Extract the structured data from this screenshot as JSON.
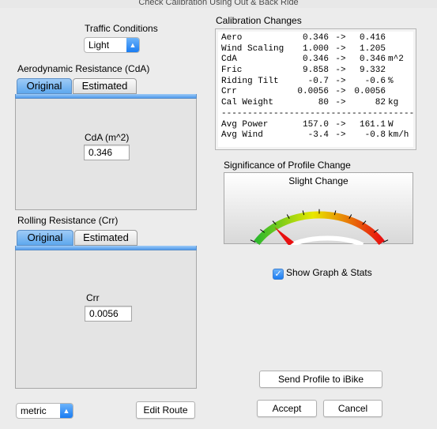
{
  "window": {
    "title": "Check Calibration Using Out & Back Ride"
  },
  "traffic": {
    "label": "Traffic Conditions",
    "selected": "Light"
  },
  "cda": {
    "section_label": "Aerodynamic Resistance (CdA)",
    "tabs": [
      "Original",
      "Estimated"
    ],
    "field_label": "CdA (m^2)",
    "value": "0.346"
  },
  "crr": {
    "section_label": "Rolling Resistance (Crr)",
    "tabs": [
      "Original",
      "Estimated"
    ],
    "field_label": "Crr",
    "value": "0.0056"
  },
  "units": {
    "selected": "metric"
  },
  "buttons": {
    "edit_route": "Edit Route",
    "send_profile": "Send Profile to iBike",
    "accept": "Accept",
    "cancel": "Cancel"
  },
  "calibration": {
    "title": "Calibration Changes",
    "rows": [
      {
        "name": "Aero",
        "old": "0.346",
        "arrow": "->",
        "new": "0.416",
        "unit": ""
      },
      {
        "name": "Wind Scaling",
        "old": "1.000",
        "arrow": "->",
        "new": "1.205",
        "unit": ""
      },
      {
        "name": "CdA",
        "old": "0.346",
        "arrow": "->",
        "new": "0.346",
        "unit": "m^2"
      },
      {
        "name": "Fric",
        "old": "9.858",
        "arrow": "->",
        "new": "9.332",
        "unit": ""
      },
      {
        "name": "Riding Tilt",
        "old": "-0.7",
        "arrow": "->",
        "new": "-0.6",
        "unit": "%"
      },
      {
        "name": "Crr",
        "old": "0.0056",
        "arrow": "->",
        "new": "0.0056",
        "unit": ""
      },
      {
        "name": "Cal Weight",
        "old": "80",
        "arrow": "->",
        "new": "82",
        "unit": "kg"
      }
    ],
    "separator": "--------------------------------------",
    "summary_rows": [
      {
        "name": "Avg Power",
        "old": "157.0",
        "arrow": "->",
        "new": "161.1",
        "unit": "W"
      },
      {
        "name": "Avg Wind",
        "old": "-3.4",
        "arrow": "->",
        "new": "-0.8",
        "unit": "km/h"
      }
    ]
  },
  "significance": {
    "title": "Significance of Profile Change",
    "gauge_label": "Slight Change",
    "needle_fraction": 0.18,
    "colors": {
      "low": "#2db82d",
      "mid": "#e8e800",
      "high": "#e81010",
      "needle": "#e81010"
    }
  },
  "show_graph": {
    "label": "Show Graph & Stats",
    "checked": true
  }
}
